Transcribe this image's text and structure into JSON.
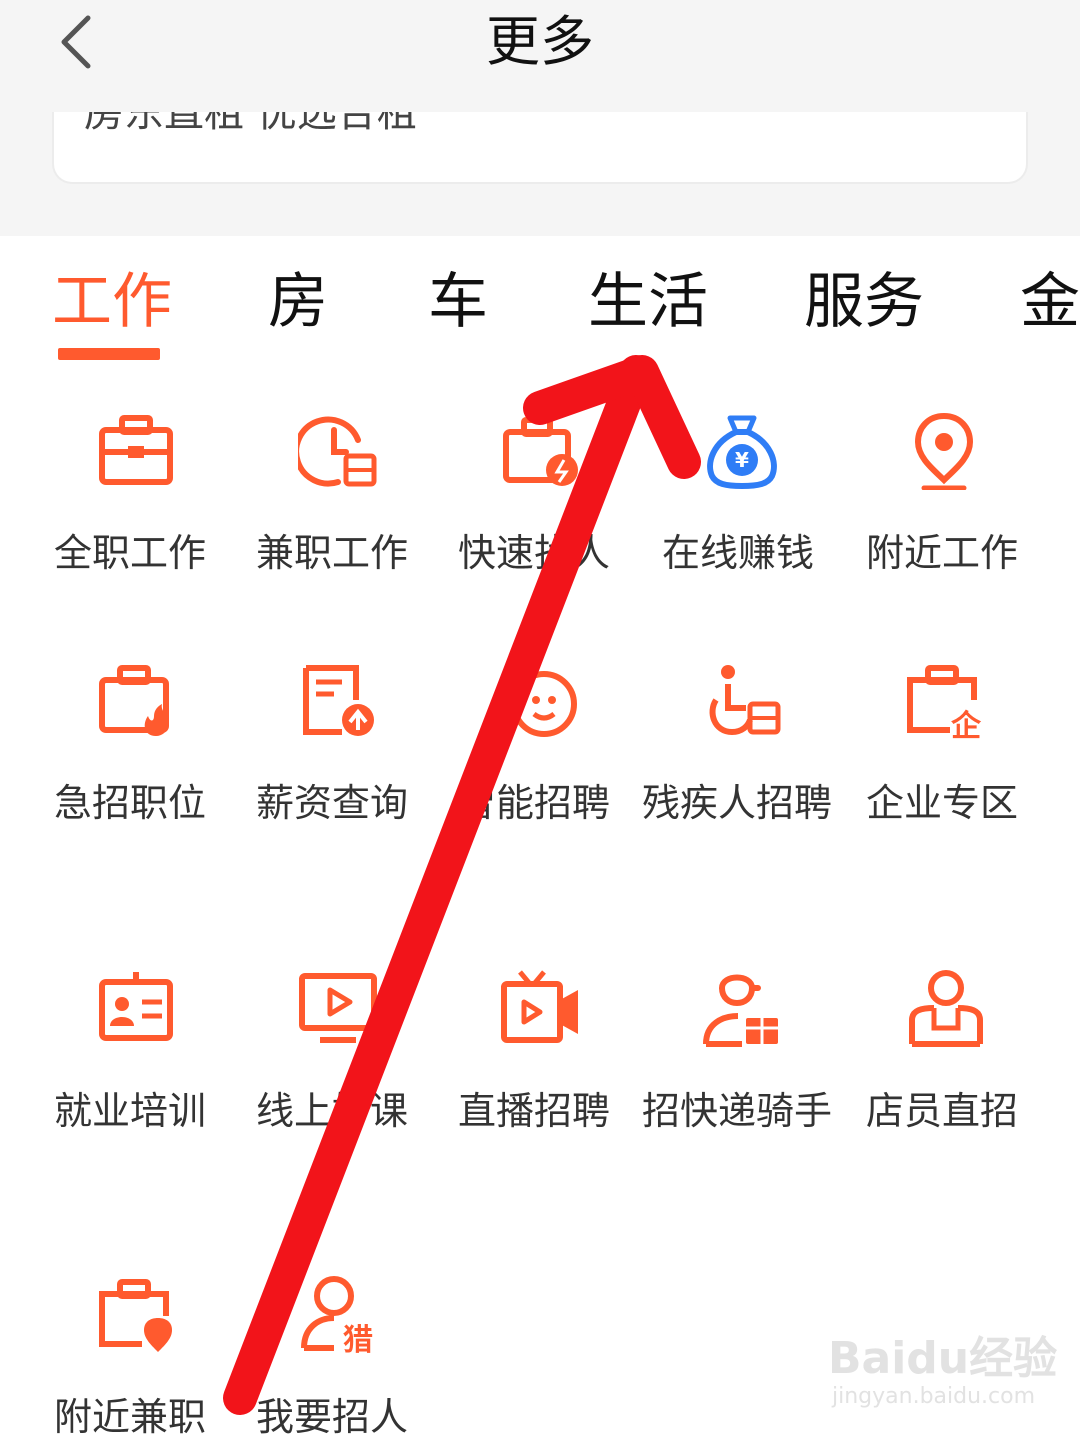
{
  "nav": {
    "title": "更多",
    "back_icon": "chevron-left-icon"
  },
  "search_card": {
    "text": "房东直租  优选合租"
  },
  "tabs": [
    {
      "label": "工作",
      "active": true
    },
    {
      "label": "房",
      "active": false
    },
    {
      "label": "车",
      "active": false
    },
    {
      "label": "生活",
      "active": false
    },
    {
      "label": "服务",
      "active": false
    },
    {
      "label": "金",
      "active": false
    }
  ],
  "grid": [
    {
      "label": "全职工作",
      "icon": "briefcase-icon"
    },
    {
      "label": "兼职工作",
      "icon": "clock-briefcase-icon"
    },
    {
      "label": "快速找人",
      "icon": "lightning-briefcase-icon"
    },
    {
      "label": "在线赚钱",
      "icon": "money-bag-icon"
    },
    {
      "label": "附近工作",
      "icon": "location-pin-icon"
    },
    {
      "label": "急招职位",
      "icon": "fire-briefcase-icon"
    },
    {
      "label": "薪资查询",
      "icon": "salary-document-icon"
    },
    {
      "label": "智能招聘",
      "icon": "robot-icon"
    },
    {
      "label": "残疾人招聘",
      "icon": "wheelchair-icon"
    },
    {
      "label": "企业专区",
      "icon": "enterprise-briefcase-icon"
    },
    {
      "label": "就业培训",
      "icon": "id-card-icon"
    },
    {
      "label": "线上好课",
      "icon": "video-monitor-icon"
    },
    {
      "label": "直播招聘",
      "icon": "live-tv-icon"
    },
    {
      "label": "招快递骑手",
      "icon": "courier-icon"
    },
    {
      "label": "店员直招",
      "icon": "shop-assistant-icon"
    },
    {
      "label": "附近兼职",
      "icon": "location-briefcase-icon"
    },
    {
      "label": "我要招人",
      "icon": "headhunter-icon"
    }
  ],
  "watermark": {
    "logo": "Baidu经验",
    "url": "jingyan.baidu.com"
  },
  "colors": {
    "accent": "#ff5a2e",
    "blue_icon": "#2f7df6",
    "arrow": "#f2141a"
  }
}
